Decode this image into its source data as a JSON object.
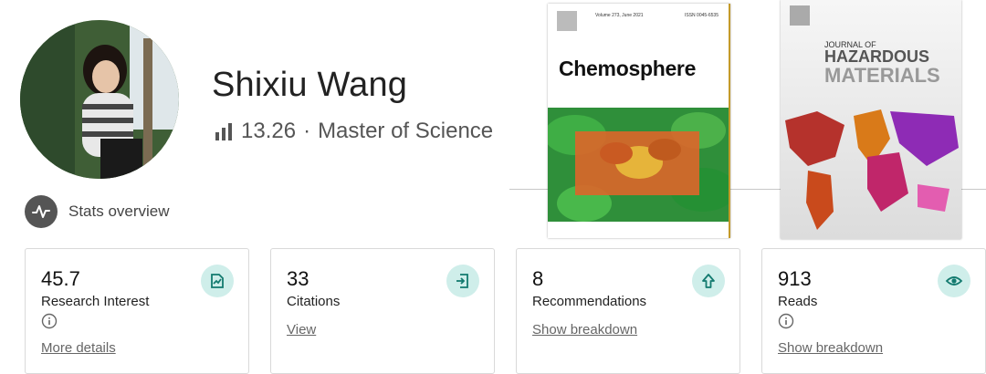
{
  "profile": {
    "name": "Shixiu Wang",
    "score": "13.26",
    "separator": "·",
    "degree": "Master of Science"
  },
  "stats_overview": {
    "label": "Stats overview"
  },
  "covers": [
    {
      "journal": "Chemosphere",
      "header_text": "Volume 273, June 2021",
      "issn": "ISSN 0045-6535"
    },
    {
      "journal_line1": "JOURNAL OF",
      "journal_line2": "HAZARDOUS",
      "journal_line3": "MATERIALS"
    }
  ],
  "cards": [
    {
      "value": "45.7",
      "label": "Research Interest",
      "link": "More details",
      "icon": "research-interest-icon"
    },
    {
      "value": "33",
      "label": "Citations",
      "link": "View",
      "icon": "citations-icon"
    },
    {
      "value": "8",
      "label": "Recommendations",
      "link": "Show breakdown",
      "icon": "recommendations-icon"
    },
    {
      "value": "913",
      "label": "Reads",
      "link": "Show breakdown",
      "icon": "reads-icon"
    }
  ],
  "colors": {
    "accent_badge": "#cfeeea",
    "accent_icon": "#137a6f",
    "text_muted": "#555555"
  }
}
